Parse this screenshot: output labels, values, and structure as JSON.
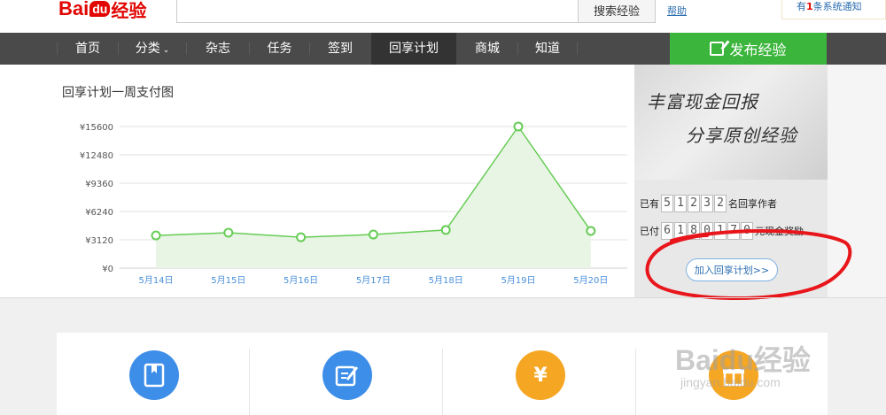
{
  "header": {
    "logo_bai": "Bai",
    "logo_du": "du",
    "logo_jingyan": "经验",
    "search_button": "搜索经验",
    "help": "帮助",
    "notice_prefix": "有",
    "notice_count": "1",
    "notice_suffix": "条系统通知"
  },
  "nav": {
    "items": [
      {
        "label": "首页"
      },
      {
        "label": "分类"
      },
      {
        "label": "杂志"
      },
      {
        "label": "任务"
      },
      {
        "label": "签到"
      },
      {
        "label": "回享计划"
      },
      {
        "label": "商城"
      },
      {
        "label": "知道"
      }
    ],
    "publish": "发布经验",
    "active_index": 5
  },
  "chart": {
    "title": "回享计划一周支付图"
  },
  "chart_data": {
    "type": "area",
    "title": "回享计划一周支付图",
    "categories": [
      "5月14日",
      "5月15日",
      "5月16日",
      "5月17日",
      "5月18日",
      "5月19日",
      "5月20日"
    ],
    "values": [
      3600,
      3900,
      3400,
      3700,
      4200,
      15600,
      4100
    ],
    "y_ticks": [
      "¥0",
      "¥3120",
      "¥6240",
      "¥9360",
      "¥12480",
      "¥15600"
    ],
    "ylim": [
      0,
      15600
    ],
    "grid": true,
    "colors": {
      "line": "#66cc55",
      "fill": "#e8f5e4",
      "point_fill": "#ffffff"
    }
  },
  "promo": {
    "line1": "丰富现金回报",
    "line2": "分享原创经验",
    "authors_prefix": "已有",
    "authors_digits": [
      "5",
      "1",
      "2",
      "3",
      "2"
    ],
    "authors_suffix": "名回享作者",
    "paid_prefix": "已付",
    "paid_digits": [
      "6",
      "1",
      "8",
      "0",
      "1",
      "7",
      "0"
    ],
    "paid_suffix": "元现金奖励",
    "join_button": "加入回享计划>>"
  },
  "cards": [
    {
      "icon": "book-icon",
      "color": "#3d8ee8"
    },
    {
      "icon": "edit-icon",
      "color": "#3d8ee8"
    },
    {
      "icon": "money-bag-icon",
      "color": "#f5a623",
      "glyph": "¥"
    },
    {
      "icon": "gift-icon",
      "color": "#f5a623"
    }
  ],
  "watermark": {
    "main": "Baidu经验",
    "sub": "jingyan.baidu.com"
  }
}
